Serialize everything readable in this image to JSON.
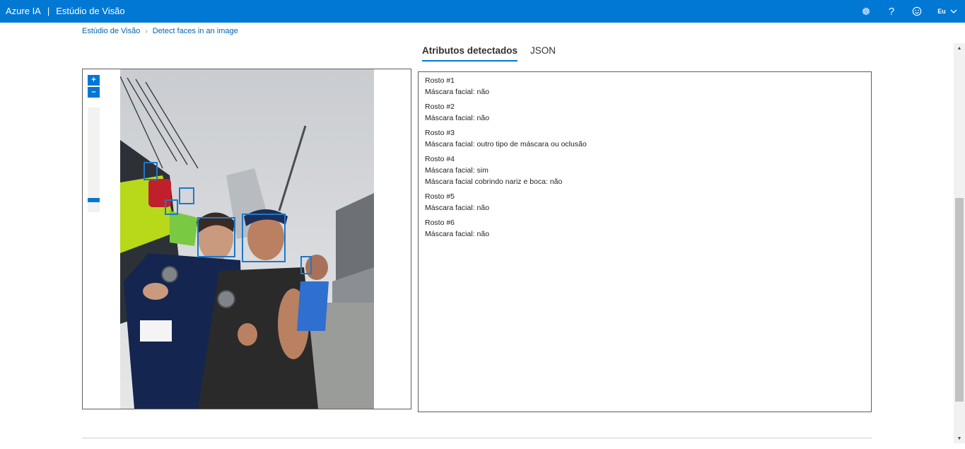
{
  "header": {
    "product": "Azure IA",
    "separator": "|",
    "app": "Estúdio de Visão",
    "icons": [
      "gear-icon",
      "help-icon",
      "smiley-icon"
    ],
    "account_label": "Eu"
  },
  "breadcrumb": {
    "home": "Estúdio de Visão",
    "current": "Detect faces in an image"
  },
  "tabs": [
    {
      "label": "Atributos detectados",
      "active": true
    },
    {
      "label": "JSON",
      "active": false
    }
  ],
  "zoom": {
    "in_label": "+",
    "out_label": "–",
    "level": 0.9
  },
  "faces": [
    {
      "title": "Rosto #1",
      "lines": [
        "Máscara facial: não"
      ]
    },
    {
      "title": "Rosto #2",
      "lines": [
        "Máscara facial: não"
      ]
    },
    {
      "title": "Rosto #3",
      "lines": [
        "Máscara facial: outro tipo de máscara ou oclusão"
      ]
    },
    {
      "title": "Rosto #4",
      "lines": [
        "Máscara facial: sim",
        "Máscara facial cobrindo nariz e boca: não"
      ]
    },
    {
      "title": "Rosto #5",
      "lines": [
        "Máscara facial: não"
      ]
    },
    {
      "title": "Rosto #6",
      "lines": [
        "Máscara facial: não"
      ]
    }
  ],
  "colors": {
    "accent": "#0078d4",
    "face_box": "#1e78c8"
  }
}
